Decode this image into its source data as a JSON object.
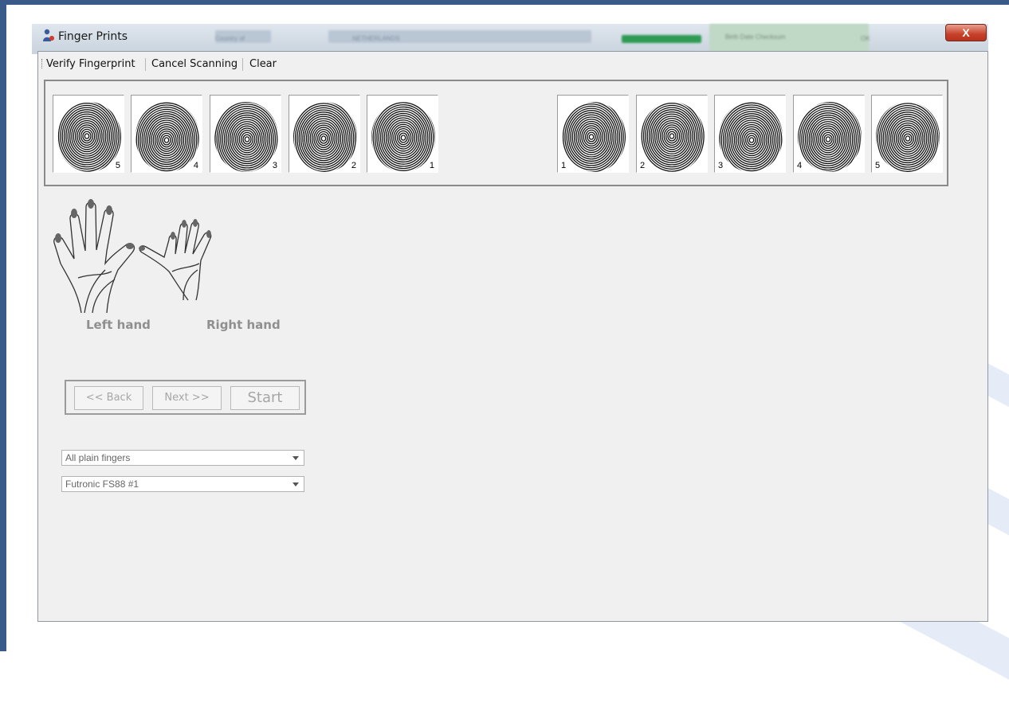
{
  "window": {
    "title": "Finger Prints",
    "close_label": "X"
  },
  "toolbar": {
    "items": [
      "Verify Fingerprint",
      "Cancel Scanning",
      "Clear"
    ]
  },
  "fingerprints": {
    "left": [
      "5",
      "4",
      "3",
      "2",
      "1"
    ],
    "right": [
      "1",
      "2",
      "3",
      "4",
      "5"
    ]
  },
  "hands": {
    "left_label": "Left hand",
    "right_label": "Right hand"
  },
  "navigation": {
    "back_label": "<< Back",
    "next_label": "Next >>",
    "start_label": "Start"
  },
  "dropdowns": {
    "capture_mode": "All plain fingers",
    "scanner": "Futronic FS88 #1"
  },
  "background_window": {
    "blurred_texts": [
      "Country of",
      "NETHERLANDS",
      "Birth Date Checksum",
      "OK"
    ]
  },
  "colors": {
    "frame_border": "#3a5a8a",
    "window_bg": "#f0f0f0",
    "close_button": "#c7412a",
    "disabled_text": "#a6a6a6"
  }
}
